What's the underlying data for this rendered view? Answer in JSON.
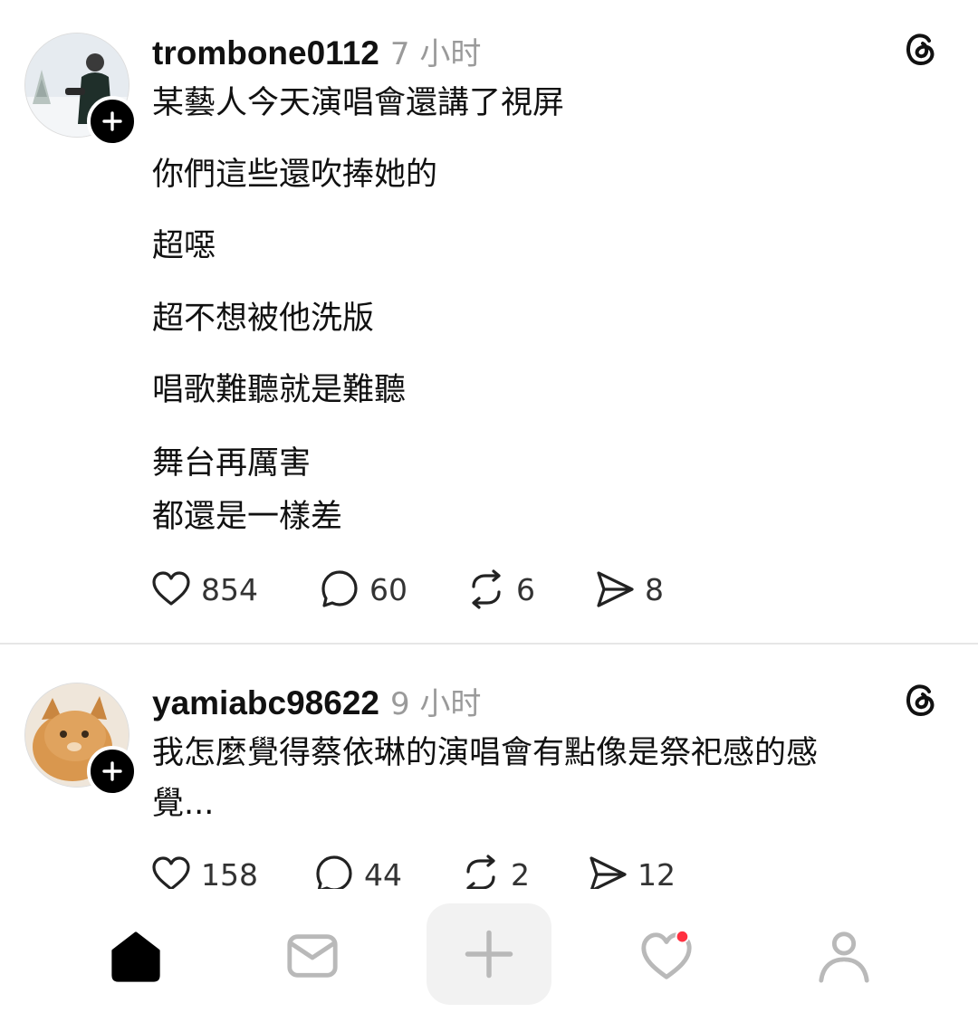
{
  "posts": [
    {
      "username": "trombone0112",
      "time": "7 小时",
      "lines": [
        "某藝人今天演唱會還講了視屏",
        "你們這些還吹捧她的",
        "超噁",
        "超不想被他洗版",
        "唱歌難聽就是難聽",
        "舞台再厲害",
        "都還是一樣差"
      ],
      "counts": {
        "likes": "854",
        "replies": "60",
        "reposts": "6",
        "shares": "8"
      }
    },
    {
      "username": "yamiabc98622",
      "time": "9 小时",
      "lines": [
        "我怎麼覺得蔡依琳的演唱會有點像是祭祀感的感",
        "覺..."
      ],
      "counts": {
        "likes": "158",
        "replies": "44",
        "reposts": "2",
        "shares": "12"
      }
    }
  ],
  "icons": {
    "follow": "plus-icon",
    "threads": "threads-logo-icon",
    "like": "heart-icon",
    "reply": "comment-icon",
    "repost": "repost-icon",
    "share": "send-icon"
  },
  "nav": {
    "items": [
      "home-icon",
      "inbox-icon",
      "compose-plus-icon",
      "activity-heart-icon",
      "profile-icon"
    ],
    "notification_color": "#ff3040"
  }
}
